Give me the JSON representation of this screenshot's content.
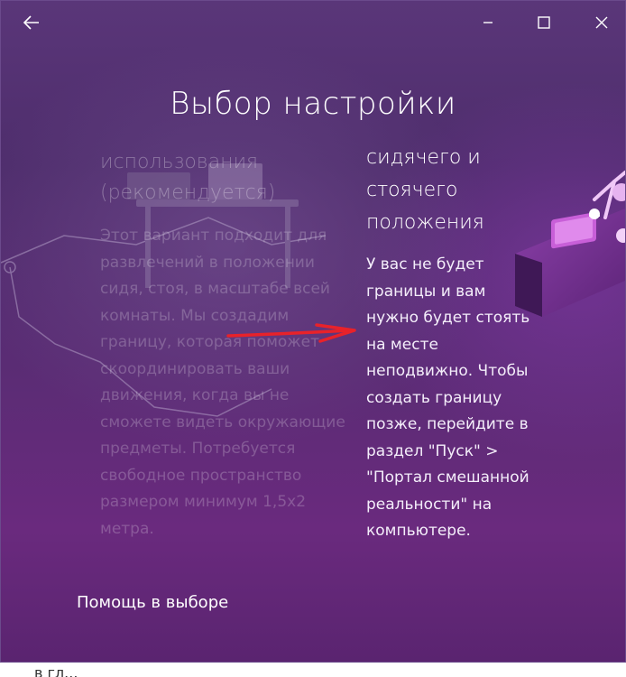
{
  "window": {
    "title": "Выбор настройки",
    "controls": [
      "back-icon",
      "minimize-icon",
      "maximize-icon",
      "close-icon"
    ]
  },
  "options": [
    {
      "heading": "использования\n(рекомендуется)",
      "body": "Этот вариант подходит для\nразвлечений в положении\nсидя, стоя, в масштабе всей\nкомнаты. Мы создадим\nграницу, которая поможет\nскоординировать ваши\nдвижения, когда вы не\nсможете видеть окружающие\nпредметы. Потребуется\nсвободное пространство\nразмером минимум 1,5x2\nметра.",
      "state": "faded"
    },
    {
      "heading": "сидячего и\nстоячего\nположения",
      "body": "У вас не будет\nграницы и вам\nнужно будет стоять\nна месте\nнеподвижно. Чтобы\nсоздать границу\nпозже, перейдите в\nраздел \"Пуск\" >\n\"Портал смешанной\nреальности\" на\nкомпьютере.",
      "state": "active"
    }
  ],
  "help_link": "Помощь в выборе",
  "annotation": {
    "type": "arrow",
    "color": "#e8222a"
  },
  "page_below": {
    "text": "в гл..."
  },
  "colors": {
    "background_top": "#5a3679",
    "background_bottom": "#6a2a7e",
    "accent_pink": "#c85fd8",
    "text": "#ffffff"
  }
}
